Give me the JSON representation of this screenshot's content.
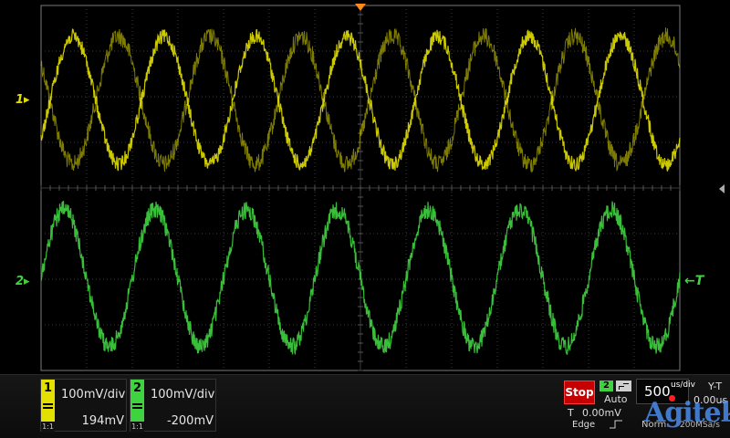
{
  "screen": {
    "ch1_marker": "1",
    "ch2_marker": "2",
    "trigger_level_marker": "←T"
  },
  "channels": [
    {
      "number": "1",
      "scale": "100mV/div",
      "offset": "194mV",
      "probe": "1:1",
      "color": "#e3e000"
    },
    {
      "number": "2",
      "scale": "100mV/div",
      "offset": "-200mV",
      "probe": "1:1",
      "color": "#3fd43f"
    }
  ],
  "run_state": {
    "label": "Stop",
    "color": "#c40000"
  },
  "trigger": {
    "source": "2",
    "mode": "Auto",
    "t_label": "T",
    "position": "0.00mV",
    "type": "Edge"
  },
  "timebase": {
    "value": "500",
    "unit": "us/div"
  },
  "acquisition": {
    "mode": "Norm",
    "sample_rate": "200MSa/s"
  },
  "display": {
    "mode": "Y-T",
    "h_position": "0.00us"
  },
  "watermark": {
    "text": "Agitek"
  },
  "icons": {
    "trigger_position": "triangle-down-icon",
    "side_panel": "chevron-left-icon",
    "slope": "rising-edge-icon",
    "coupling": "dc-coupling-icon"
  }
}
